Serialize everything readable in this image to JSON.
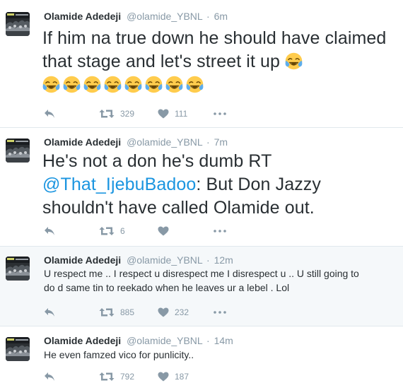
{
  "tweets": [
    {
      "name": "Olamide Adedeji",
      "handle": "@olamide_YBNL",
      "sep": "·",
      "time": "6m",
      "text": "If him na true down he should have claimed that stage and let's street it up",
      "emojis": [
        "face-with-tears-of-joy",
        "face-with-tears-of-joy",
        "face-with-tears-of-joy",
        "face-with-tears-of-joy",
        "face-with-tears-of-joy",
        "face-with-tears-of-joy",
        "face-with-tears-of-joy",
        "face-with-tears-of-joy",
        "face-with-tears-of-joy"
      ],
      "retweets": "329",
      "likes": "111"
    },
    {
      "name": "Olamide Adedeji",
      "handle": "@olamide_YBNL",
      "sep": "·",
      "time": "7m",
      "text_pre": "He's not a don he's dumb RT ",
      "mention": "@That_IjebuBadoo",
      "text_post": ": But Don Jazzy shouldn't have called Olamide out.",
      "retweets": "6",
      "likes": ""
    },
    {
      "name": "Olamide Adedeji",
      "handle": "@olamide_YBNL",
      "sep": "·",
      "time": "12m",
      "text": "U respect me .. I respect u disrespect me I disrespect u .. U still going to do d same tin to reekado when he leaves ur a lebel . Lol",
      "retweets": "885",
      "likes": "232"
    },
    {
      "name": "Olamide Adedeji",
      "handle": "@olamide_YBNL",
      "sep": "·",
      "time": "14m",
      "text": "He even famzed vico for punlicity..",
      "retweets": "792",
      "likes": "187"
    }
  ],
  "icons": {
    "reply": "reply-icon",
    "retweet": "retweet-icon",
    "like": "heart-icon",
    "more": "more-icon",
    "avatar": "album-cover-avatar"
  },
  "colors": {
    "name": "#292f33",
    "meta": "#8899a6",
    "mention": "#1b95e0",
    "highlight_bg": "#f5f8fa",
    "border": "#e1e8ed"
  }
}
